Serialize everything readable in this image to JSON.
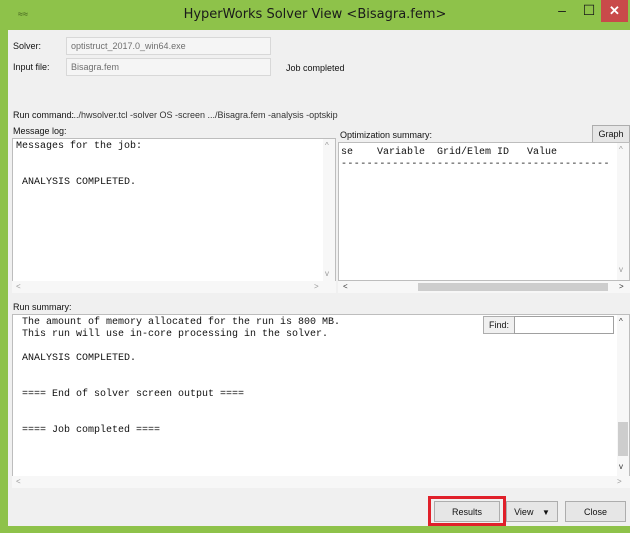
{
  "window": {
    "title": "HyperWorks Solver View <Bisagra.fem>",
    "app_icon": "hw-logo-icon",
    "accent": "#8ec24a",
    "close_color": "#c94a4a"
  },
  "form": {
    "solver_label": "Solver:",
    "solver_value": "optistruct_2017.0_win64.exe",
    "input_label": "Input file:",
    "input_value": "Bisagra.fem",
    "status": "Job completed",
    "run_command_label": "Run command:",
    "run_command_value": ".../hwsolver.tcl -solver OS -screen .../Bisagra.fem -analysis -optskip"
  },
  "message_log": {
    "label": "Message log:",
    "lines": [
      "Messages for the job:",
      "",
      "",
      " ANALYSIS COMPLETED."
    ]
  },
  "optimization": {
    "label": "Optimization summary:",
    "graph_label": "Graph",
    "header": "se    Variable  Grid/Elem ID   Value",
    "rule": "------------------------------------------"
  },
  "run_summary": {
    "label": "Run summary:",
    "find_label": "Find:",
    "find_value": "",
    "lines": [
      " The amount of memory allocated for the run is 800 MB.",
      " This run will use in-core processing in the solver.",
      "",
      " ANALYSIS COMPLETED.",
      "",
      "",
      " ==== End of solver screen output ====",
      "",
      "",
      " ==== Job completed ===="
    ]
  },
  "footer": {
    "results_label": "Results",
    "view_label": "View",
    "close_label": "Close",
    "highlight_color": "#e0202a"
  }
}
